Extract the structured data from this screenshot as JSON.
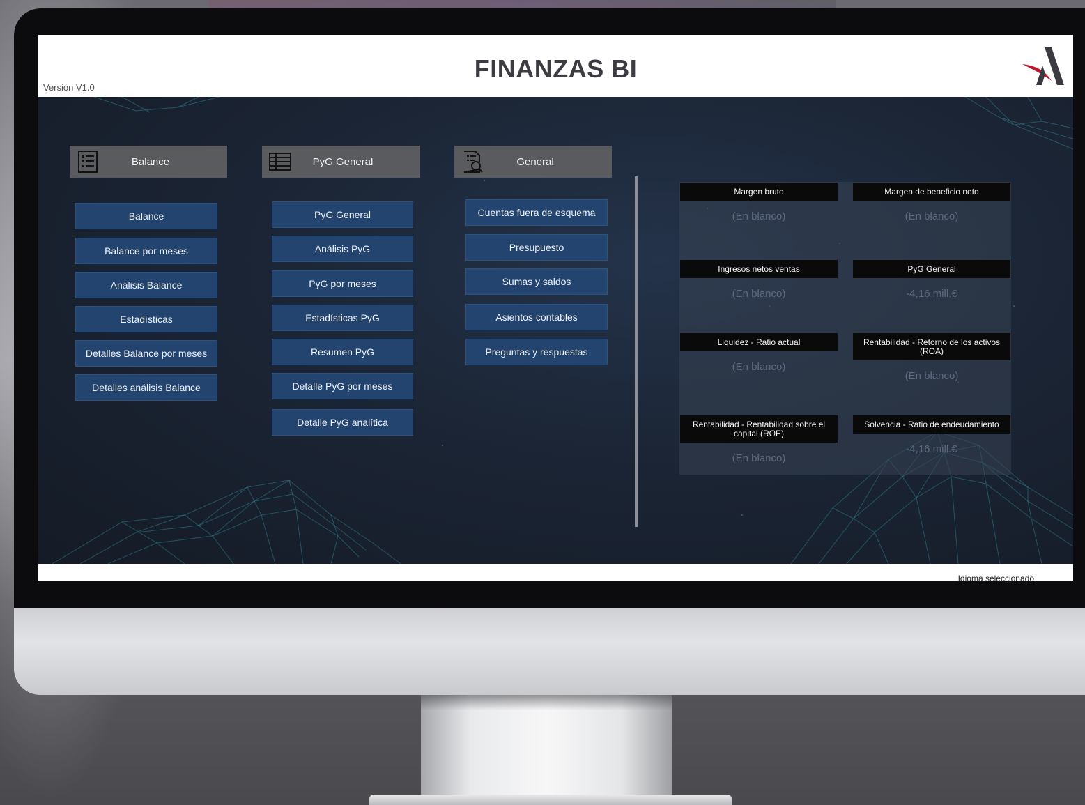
{
  "app": {
    "title": "FINANZAS BI",
    "version": "Versión V1.0",
    "language_label": "Idioma seleccionado"
  },
  "sections": {
    "balance": {
      "header": "Balance",
      "icon": "list-icon",
      "items": [
        "Balance",
        "Balance por meses",
        "Análisis Balance",
        "Estadísticas",
        "Detalles Balance por meses",
        "Detalles análisis Balance"
      ]
    },
    "pyg": {
      "header": "PyG General",
      "icon": "table-icon",
      "items": [
        "PyG General",
        "Análisis PyG",
        "PyG por meses",
        "Estadísticas PyG",
        "Resumen PyG",
        "Detalle PyG por meses",
        "Detalle PyG analítica"
      ]
    },
    "general": {
      "header": "General",
      "icon": "document-search-icon",
      "items": [
        "Cuentas fuera de esquema",
        "Presupuesto",
        "Sumas y saldos",
        "Asientos contables",
        "Preguntas y respuestas"
      ]
    }
  },
  "kpis": [
    {
      "title": "Margen bruto",
      "value": "(En blanco)"
    },
    {
      "title": "Margen de beneficio neto",
      "value": "(En blanco)"
    },
    {
      "title": "Ingresos netos ventas",
      "value": "(En blanco)"
    },
    {
      "title": "PyG General",
      "value": "-4,16 mill.€"
    },
    {
      "title": "Liquidez - Ratio actual",
      "value": "(En blanco)"
    },
    {
      "title": "Rentabilidad - Retorno de los activos (ROA)",
      "value": "(En blanco)"
    },
    {
      "title": "Rentabilidad - Rentabilidad sobre el capital (ROE)",
      "value": "(En blanco)"
    },
    {
      "title": "Solvencia - Ratio de endeudamiento",
      "value": "-4,16 mill.€"
    }
  ],
  "colors": {
    "button_bg": "#23446e",
    "header_bg": "#5a5b5e",
    "dashboard_bg": "#1b2535",
    "logo_red": "#c0182c",
    "logo_dark": "#3a3a40"
  }
}
